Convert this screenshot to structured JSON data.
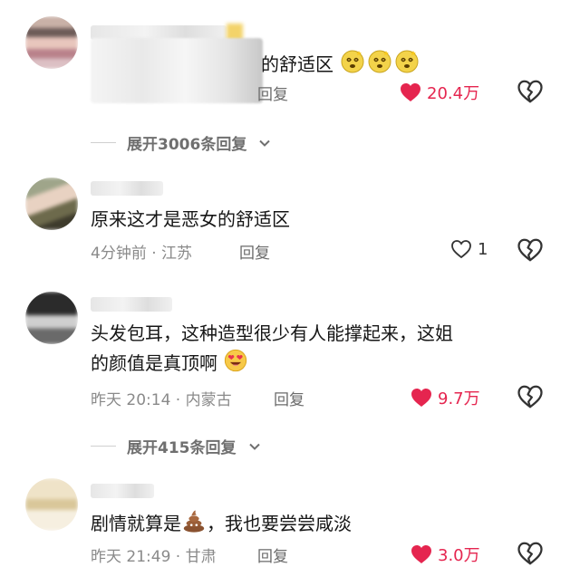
{
  "comments": [
    {
      "text": "的舒适区",
      "meta": "",
      "reply_label": "回复",
      "likes": "20.4万",
      "liked": true,
      "expand_label": "展开3006条回复"
    },
    {
      "text": "原来这才是恶女的舒适区",
      "meta": "4分钟前 · 江苏",
      "reply_label": "回复",
      "likes": "1",
      "liked": false
    },
    {
      "text_line1": "头发包耳，这种造型很少有人能撑起来，这姐",
      "text_line2": "的颜值是真顶啊",
      "meta": "昨天 20:14 · 内蒙古",
      "reply_label": "回复",
      "likes": "9.7万",
      "liked": true,
      "expand_label": "展开415条回复"
    },
    {
      "text_a": "剧情就算是",
      "text_b": "，我也要尝尝咸淡",
      "meta": "昨天 21:49 · 甘肃",
      "reply_label": "回复",
      "likes": "3.0万",
      "liked": true
    }
  ],
  "colors": {
    "like_red": "#e5254f",
    "meta_gray": "#8a8a8a"
  },
  "icons": [
    "heart-filled-icon",
    "heart-outline-icon",
    "broken-heart-icon",
    "chevron-down-icon",
    "dizzy-face-emoji",
    "heart-eyes-emoji",
    "poop-emoji"
  ]
}
